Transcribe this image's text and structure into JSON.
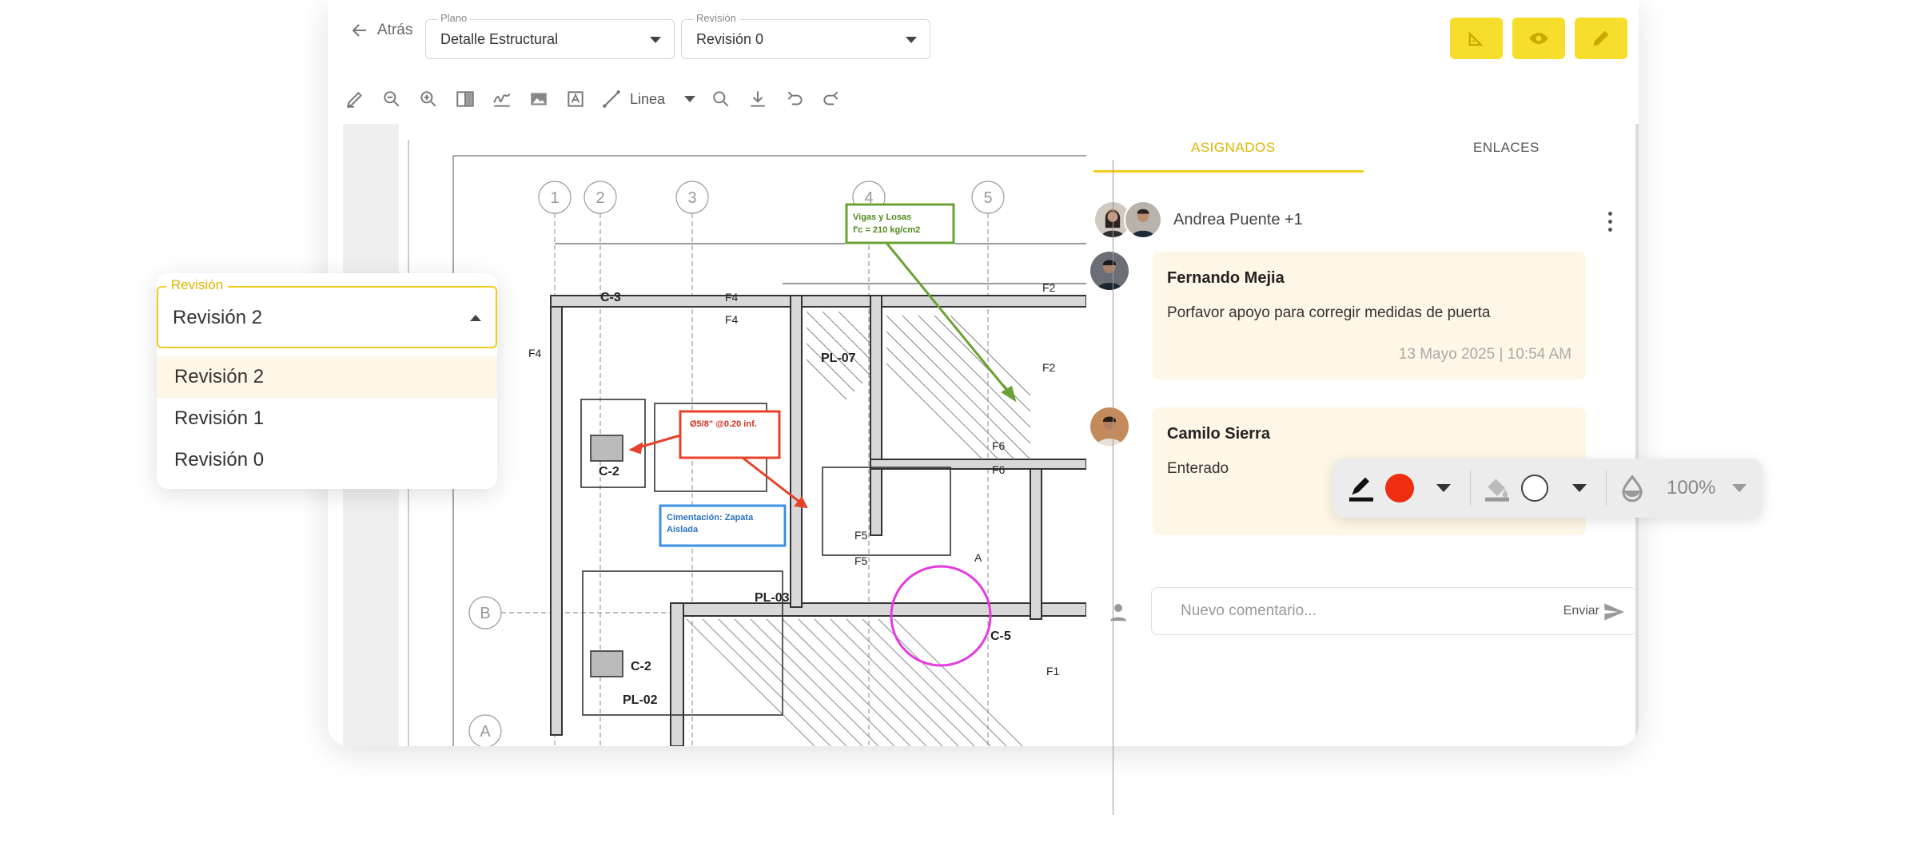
{
  "header": {
    "back_label": "Atrás",
    "plano_label": "Plano",
    "plano_value": "Detalle Estructural",
    "revision_label": "Revisión",
    "revision_value": "Revisión 0"
  },
  "toolbar": {
    "tools": [
      "pencil-icon",
      "zoom-out-icon",
      "zoom-in-icon",
      "split-view-icon",
      "signature-icon",
      "image-icon",
      "text-box-icon"
    ],
    "line_tool_label": "Linea",
    "trailing_tools": [
      "search-icon",
      "download-icon",
      "undo-icon",
      "redo-icon"
    ]
  },
  "action_buttons": [
    "ruler-icon",
    "eye-icon",
    "pencil-icon"
  ],
  "panel": {
    "tabs": [
      {
        "label": "ASIGNADOS",
        "active": true
      },
      {
        "label": "ENLACES",
        "active": false
      }
    ],
    "assignees_text": "Andrea Puente +1",
    "comments": [
      {
        "author": "Fernando Mejia",
        "text": "Porfavor apoyo para corregir medidas de puerta",
        "date": "13 Mayo 2025 | 10:54 AM"
      },
      {
        "author": "Camilo Sierra",
        "text": "Enterado",
        "date": ""
      }
    ],
    "composer": {
      "placeholder": "Nuevo comentario...",
      "send_label": "Enviar"
    }
  },
  "revision_dropdown": {
    "label": "Revisión",
    "selected": "Revisión 2",
    "options": [
      "Revisión 2",
      "Revisión 1",
      "Revisión 0"
    ]
  },
  "style_toolbar": {
    "stroke_color": "#ef2d0f",
    "fill_color": "#ffffff",
    "opacity": "100%"
  },
  "plan_annotations": {
    "green_note_line1": "Vigas y Losas",
    "green_note_line2": "f'c = 210 kg/cm2",
    "red_note": "Ø5/8\" @0.20 inf.",
    "blue_note_line1": "Cimentación: Zapata",
    "blue_note_line2": "Aislada",
    "axis_labels": [
      "1",
      "2",
      "3",
      "4",
      "5",
      "B",
      "A"
    ],
    "labels": [
      "C-3",
      "C-2",
      "C-2",
      "PL-07",
      "PL-03",
      "PL-02",
      "C-5",
      "F4",
      "F4",
      "F4",
      "F2",
      "F2",
      "F6",
      "F6",
      "F5",
      "F5",
      "F1",
      "A"
    ]
  },
  "colors": {
    "accent_yellow": "#f7dd2c",
    "tab_active": "#e0b400",
    "comment_bg": "#fef6e6",
    "note_green": "#6aa233",
    "note_red": "#e8412a",
    "note_blue": "#3d8fe0",
    "note_magenta": "#e33be0"
  }
}
